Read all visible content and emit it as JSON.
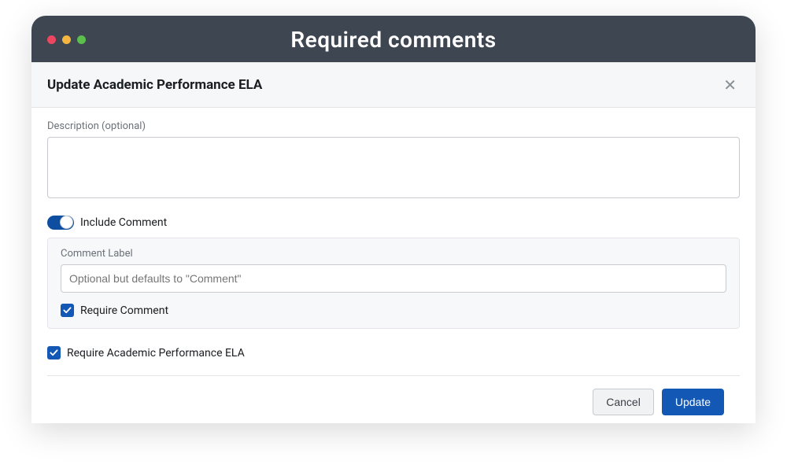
{
  "window": {
    "title": "Required comments"
  },
  "modal": {
    "title": "Update Academic Performance ELA",
    "description": {
      "label": "Description (optional)",
      "value": ""
    },
    "includeComment": {
      "label": "Include Comment",
      "enabled": true
    },
    "commentSection": {
      "labelText": "Comment Label",
      "placeholder": "Optional but defaults to \"Comment\"",
      "value": "",
      "requireComment": {
        "label": "Require Comment",
        "checked": true
      }
    },
    "requireField": {
      "label": "Require Academic Performance ELA",
      "checked": true
    },
    "footer": {
      "cancel": "Cancel",
      "update": "Update"
    }
  }
}
